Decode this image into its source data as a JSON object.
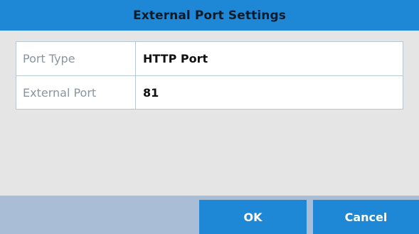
{
  "dialog": {
    "title": "External Port Settings",
    "fields": [
      {
        "label": "Port Type",
        "value": "HTTP Port"
      },
      {
        "label": "External Port",
        "value": "81"
      }
    ],
    "buttons": {
      "ok": "OK",
      "cancel": "Cancel"
    }
  },
  "colors": {
    "accent": "#1e88d6",
    "footer": "#a9bdd6",
    "panel": "#e5e5e5"
  }
}
